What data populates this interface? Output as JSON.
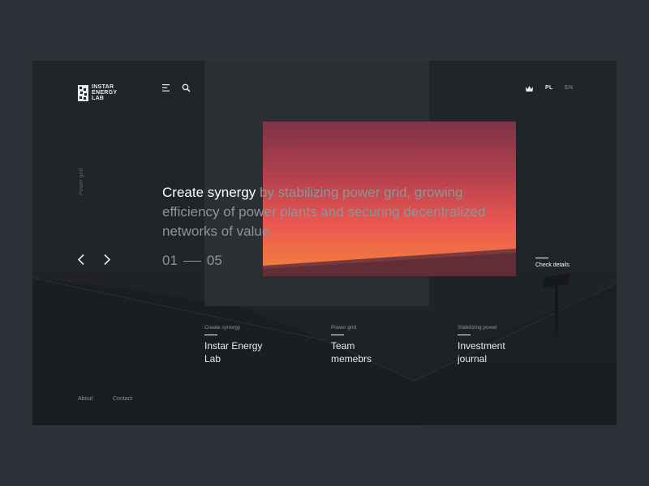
{
  "logo": {
    "text_lines": [
      "INSTAR",
      "ENERGY",
      "LAB"
    ]
  },
  "header": {
    "menu_icon": "hamburger-menu-icon",
    "search_icon": "search-icon",
    "lang_icon": "crown-icon",
    "languages": [
      "PL",
      "EN"
    ],
    "active_language": "PL"
  },
  "side_label": "Power grid",
  "hero": {
    "headline_strong": "Create synergy",
    "headline_rest": " by stabilizing power grid, growing efficiency of power plants and securing decentralized networks of value.",
    "counter_current": "01",
    "counter_total": "05",
    "cta": "Check details"
  },
  "cards": [
    {
      "kicker": "Create synergy",
      "title": "Instar Energy Lab"
    },
    {
      "kicker": "Power grid",
      "title": "Team memebrs"
    },
    {
      "kicker": "Stabilizing power",
      "title": "Investment journal"
    }
  ],
  "footer": {
    "about": "About",
    "contact": "Contact"
  },
  "colors": {
    "background": "#2e3238",
    "frame": "#1f2226",
    "panel": "#2b2f34",
    "text_primary": "#ffffff",
    "text_muted": "#8f939a",
    "photo_gradient": [
      "#7d3347",
      "#b3404d",
      "#ea5650",
      "#f2833f"
    ]
  }
}
